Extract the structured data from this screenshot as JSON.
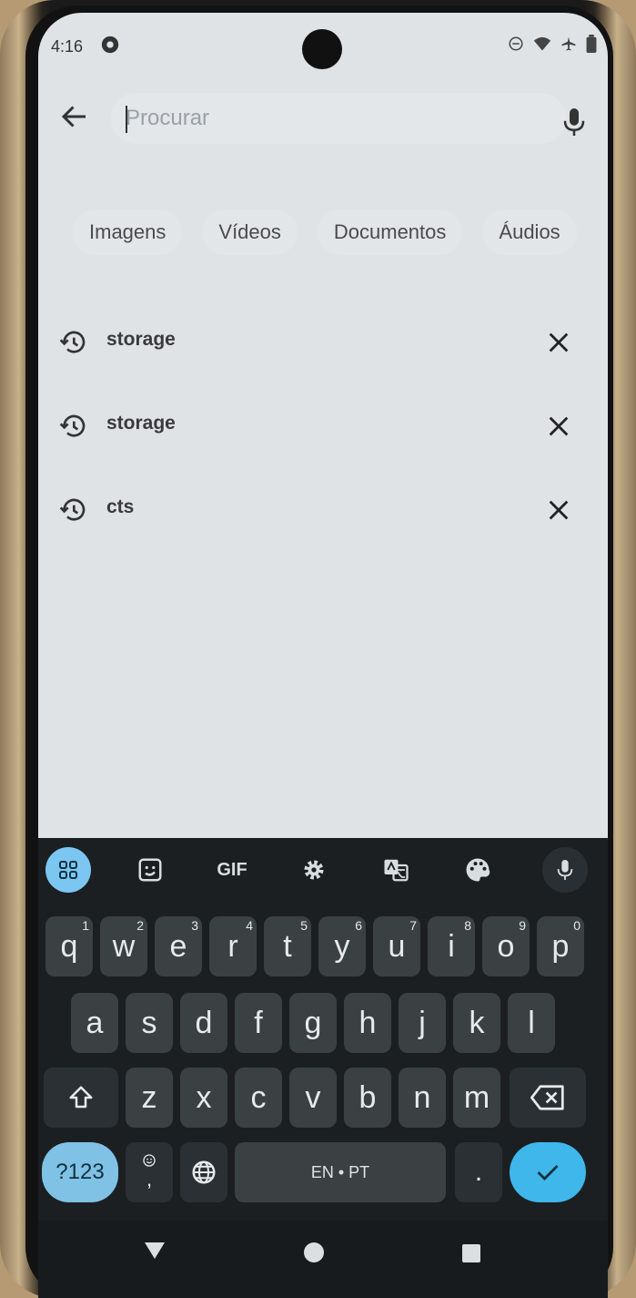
{
  "status": {
    "time": "4:16"
  },
  "search": {
    "placeholder": "Procurar"
  },
  "chips": [
    "Imagens",
    "Vídeos",
    "Documentos",
    "Áudios"
  ],
  "history": [
    {
      "text": "storage"
    },
    {
      "text": "storage"
    },
    {
      "text": "cts"
    }
  ],
  "keyboard": {
    "toolbar": {
      "gif_label": "GIF"
    },
    "row1": [
      {
        "k": "q",
        "n": "1"
      },
      {
        "k": "w",
        "n": "2"
      },
      {
        "k": "e",
        "n": "3"
      },
      {
        "k": "r",
        "n": "4"
      },
      {
        "k": "t",
        "n": "5"
      },
      {
        "k": "y",
        "n": "6"
      },
      {
        "k": "u",
        "n": "7"
      },
      {
        "k": "i",
        "n": "8"
      },
      {
        "k": "o",
        "n": "9"
      },
      {
        "k": "p",
        "n": "0"
      }
    ],
    "row2": [
      "a",
      "s",
      "d",
      "f",
      "g",
      "h",
      "j",
      "k",
      "l"
    ],
    "row3": [
      "z",
      "x",
      "c",
      "v",
      "b",
      "n",
      "m"
    ],
    "symbols_label": "?123",
    "comma_label": ",",
    "space_label": "EN • PT",
    "period_label": "."
  },
  "colors": {
    "accent": "#3fb7ea",
    "screen_bg": "#dfe3e6",
    "keyboard_bg": "#1b1f22"
  }
}
